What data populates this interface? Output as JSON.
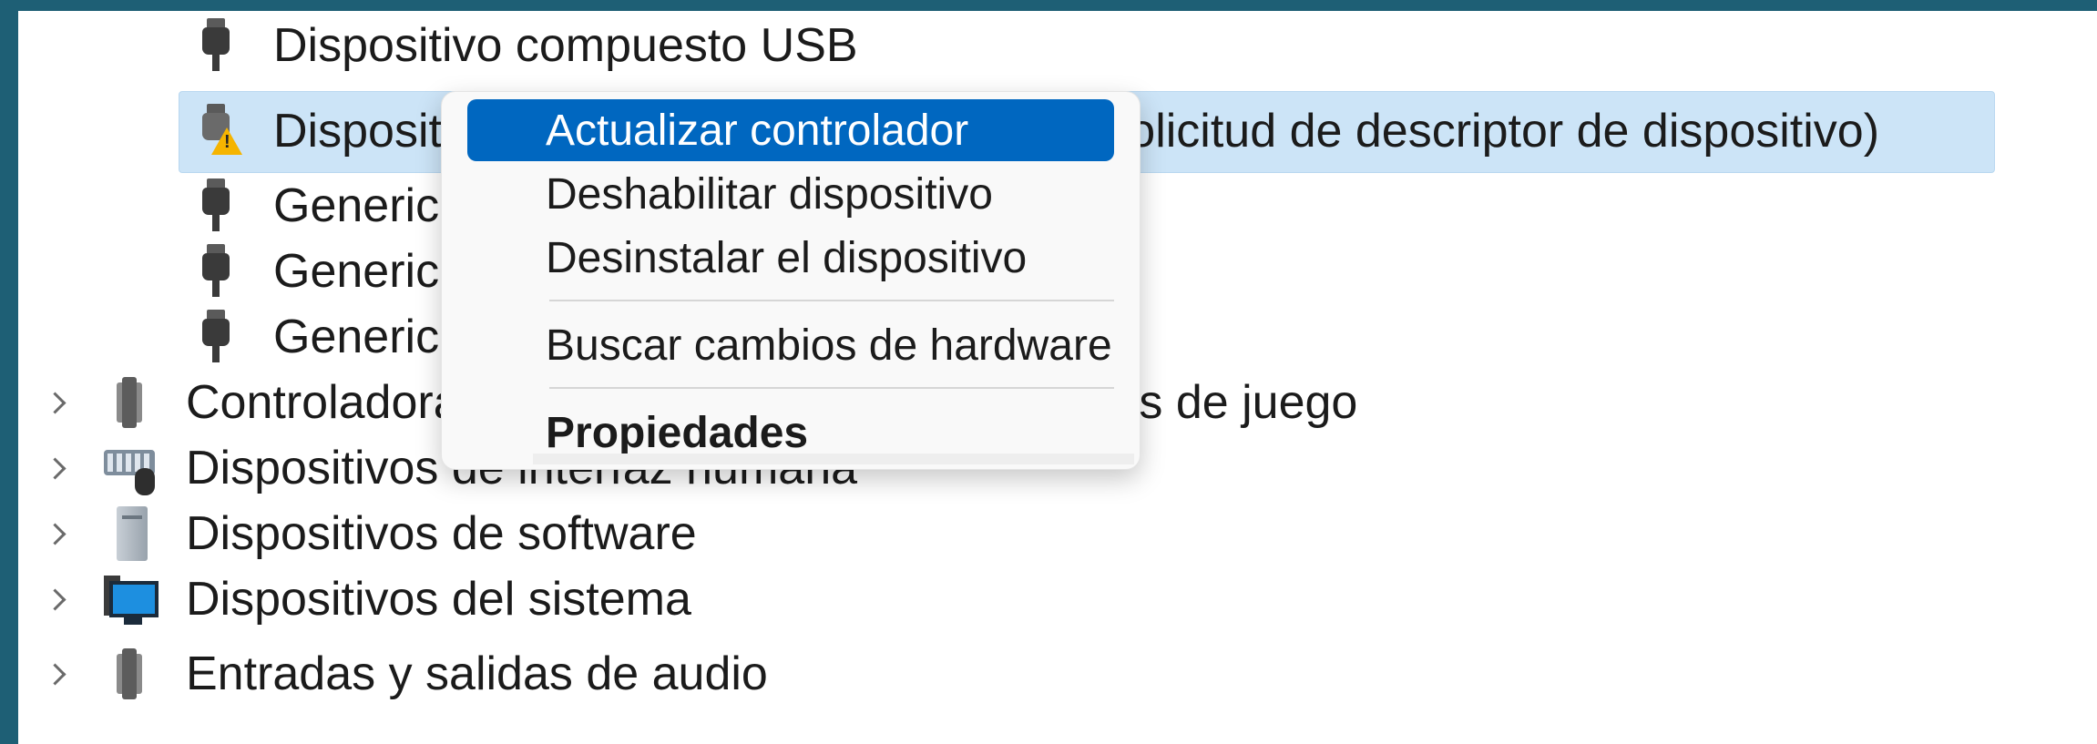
{
  "tree": {
    "usb_children": [
      {
        "label": "Dispositivo compuesto USB",
        "icon": "usb-plug-icon"
      },
      {
        "label": "Dispositivo USB desconocido (Error de solicitud de descriptor de dispositivo)",
        "icon": "usb-warning-icon",
        "selected": true
      },
      {
        "label": "Generic USB Hub",
        "icon": "usb-plug-icon"
      },
      {
        "label": "Generic USB Hub",
        "icon": "usb-plug-icon"
      },
      {
        "label": "Generic USB Hub",
        "icon": "usb-plug-icon"
      }
    ],
    "categories": [
      {
        "label": "Controladoras de sonido y vídeo y dispositivos de juego",
        "icon": "speaker-icon"
      },
      {
        "label": "Dispositivos de interfaz humana",
        "icon": "keyboard-mouse-icon"
      },
      {
        "label": "Dispositivos de software",
        "icon": "software-device-icon"
      },
      {
        "label": "Dispositivos del sistema",
        "icon": "system-devices-icon"
      },
      {
        "label": "Entradas y salidas de audio",
        "icon": "speaker-icon"
      }
    ]
  },
  "context_menu": {
    "items": [
      {
        "label": "Actualizar controlador"
      },
      {
        "label": "Deshabilitar dispositivo"
      },
      {
        "label": "Desinstalar el dispositivo"
      },
      {
        "label": "Buscar cambios de hardware"
      },
      {
        "label": "Propiedades"
      }
    ]
  },
  "colors": {
    "accent": "#0067c0",
    "selection": "#cce4f7",
    "frame": "#1e5f75",
    "warning": "#f5b400"
  }
}
